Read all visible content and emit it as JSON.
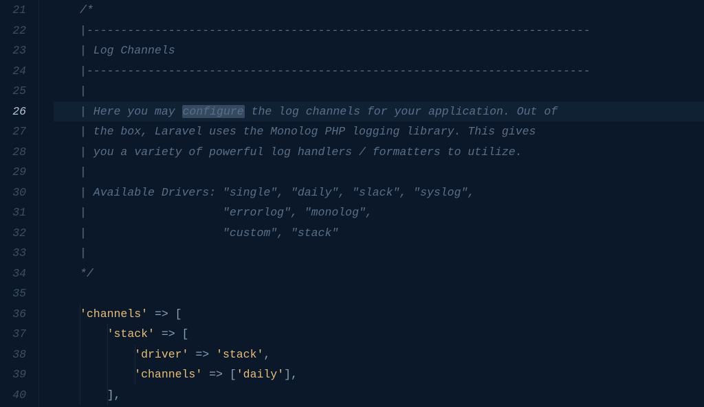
{
  "editor": {
    "startLine": 21,
    "activeLine": 26,
    "highlightWord": "configure",
    "lines": [
      {
        "type": "comment",
        "indent": 0,
        "text": "/*"
      },
      {
        "type": "comment",
        "indent": 0,
        "text": "|--------------------------------------------------------------------------"
      },
      {
        "type": "comment",
        "indent": 0,
        "text": "| Log Channels"
      },
      {
        "type": "comment",
        "indent": 0,
        "text": "|--------------------------------------------------------------------------"
      },
      {
        "type": "comment",
        "indent": 0,
        "text": "|"
      },
      {
        "type": "comment",
        "indent": 0,
        "text": "| Here you may configure the log channels for your application. Out of"
      },
      {
        "type": "comment",
        "indent": 0,
        "text": "| the box, Laravel uses the Monolog PHP logging library. This gives"
      },
      {
        "type": "comment",
        "indent": 0,
        "text": "| you a variety of powerful log handlers / formatters to utilize."
      },
      {
        "type": "comment",
        "indent": 0,
        "text": "|"
      },
      {
        "type": "comment",
        "indent": 0,
        "text": "| Available Drivers: \"single\", \"daily\", \"slack\", \"syslog\","
      },
      {
        "type": "comment",
        "indent": 0,
        "text": "|                    \"errorlog\", \"monolog\","
      },
      {
        "type": "comment",
        "indent": 0,
        "text": "|                    \"custom\", \"stack\""
      },
      {
        "type": "comment",
        "indent": 0,
        "text": "|"
      },
      {
        "type": "comment",
        "indent": 0,
        "text": "*/"
      },
      {
        "type": "blank",
        "indent": 0,
        "text": ""
      },
      {
        "type": "code",
        "indent": 0,
        "tokens": [
          {
            "t": "string",
            "v": "'channels'"
          },
          {
            "t": "sp",
            "v": " "
          },
          {
            "t": "arrow",
            "v": "=>"
          },
          {
            "t": "sp",
            "v": " "
          },
          {
            "t": "bracket",
            "v": "["
          }
        ]
      },
      {
        "type": "code",
        "indent": 1,
        "tokens": [
          {
            "t": "string",
            "v": "'stack'"
          },
          {
            "t": "sp",
            "v": " "
          },
          {
            "t": "arrow",
            "v": "=>"
          },
          {
            "t": "sp",
            "v": " "
          },
          {
            "t": "bracket",
            "v": "["
          }
        ]
      },
      {
        "type": "code",
        "indent": 2,
        "tokens": [
          {
            "t": "string",
            "v": "'driver'"
          },
          {
            "t": "sp",
            "v": " "
          },
          {
            "t": "arrow",
            "v": "=>"
          },
          {
            "t": "sp",
            "v": " "
          },
          {
            "t": "string",
            "v": "'stack'"
          },
          {
            "t": "punct",
            "v": ","
          }
        ]
      },
      {
        "type": "code",
        "indent": 2,
        "tokens": [
          {
            "t": "string",
            "v": "'channels'"
          },
          {
            "t": "sp",
            "v": " "
          },
          {
            "t": "arrow",
            "v": "=>"
          },
          {
            "t": "sp",
            "v": " "
          },
          {
            "t": "bracket",
            "v": "["
          },
          {
            "t": "string",
            "v": "'daily'"
          },
          {
            "t": "bracket",
            "v": "]"
          },
          {
            "t": "punct",
            "v": ","
          }
        ]
      },
      {
        "type": "code",
        "indent": 1,
        "tokens": [
          {
            "t": "bracket",
            "v": "]"
          },
          {
            "t": "punct",
            "v": ","
          }
        ]
      }
    ]
  }
}
